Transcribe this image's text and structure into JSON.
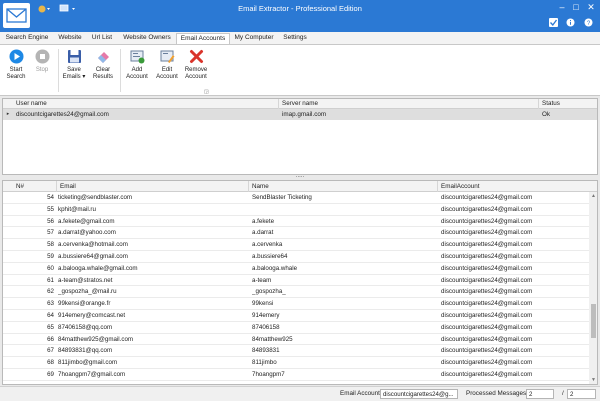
{
  "window": {
    "title": "Email Extractor - Professional Edition"
  },
  "tabs": [
    {
      "label": "Search Engine"
    },
    {
      "label": "Website"
    },
    {
      "label": "Url List"
    },
    {
      "label": "Website Owners"
    },
    {
      "label": "Email Accounts"
    },
    {
      "label": "My Computer"
    },
    {
      "label": "Settings"
    }
  ],
  "ribbon": {
    "start": "Start Search",
    "stop": "Stop",
    "save": "Save Emails ▾",
    "clear": "Clear Results",
    "add": "Add Account",
    "edit": "Edit Account",
    "remove": "Remove Account"
  },
  "accounts_grid": {
    "columns": [
      "User name",
      "Server name",
      "Status"
    ],
    "rows": [
      {
        "indicator": "▸",
        "user": "discountcigarettes24@gmail.com",
        "server": "imap.gmail.com",
        "status": "Ok"
      }
    ]
  },
  "splitter_grip": ".....",
  "emails_grid": {
    "columns": [
      "N#",
      "Email",
      "Name",
      "EmailAccount"
    ],
    "rows": [
      {
        "num": "54",
        "email": "ticketing@sendblaster.com",
        "name": "SendBlaster Ticketing",
        "account": "discountcigarettes24@gmail.com"
      },
      {
        "num": "55",
        "email": "kphit@mail.ru",
        "name": "",
        "account": "discountcigarettes24@gmail.com"
      },
      {
        "num": "56",
        "email": "a.fekete@gmail.com",
        "name": "a.fekete",
        "account": "discountcigarettes24@gmail.com"
      },
      {
        "num": "57",
        "email": "a.darrat@yahoo.com",
        "name": "a.darrat",
        "account": "discountcigarettes24@gmail.com"
      },
      {
        "num": "58",
        "email": "a.cervenka@hotmail.com",
        "name": "a.cervenka",
        "account": "discountcigarettes24@gmail.com"
      },
      {
        "num": "59",
        "email": "a.bussiere64@gmail.com",
        "name": "a.bussiere64",
        "account": "discountcigarettes24@gmail.com"
      },
      {
        "num": "60",
        "email": "a.balooga.whale@gmail.com",
        "name": "a.balooga.whale",
        "account": "discountcigarettes24@gmail.com"
      },
      {
        "num": "61",
        "email": "a-team@stratos.net",
        "name": "a-team",
        "account": "discountcigarettes24@gmail.com"
      },
      {
        "num": "62",
        "email": "_gospozha_@mail.ru",
        "name": "_gospozha_",
        "account": "discountcigarettes24@gmail.com"
      },
      {
        "num": "63",
        "email": "99kensi@orange.fr",
        "name": "99kensi",
        "account": "discountcigarettes24@gmail.com"
      },
      {
        "num": "64",
        "email": "914emery@comcast.net",
        "name": "914emery",
        "account": "discountcigarettes24@gmail.com"
      },
      {
        "num": "65",
        "email": "87406158@qq.com",
        "name": "87406158",
        "account": "discountcigarettes24@gmail.com"
      },
      {
        "num": "66",
        "email": "84matthew925@gmail.com",
        "name": "84matthew925",
        "account": "discountcigarettes24@gmail.com"
      },
      {
        "num": "67",
        "email": "84893831@qq.com",
        "name": "84893831",
        "account": "discountcigarettes24@gmail.com"
      },
      {
        "num": "68",
        "email": "811jimbo@gmail.com",
        "name": "811jimbo",
        "account": "discountcigarettes24@gmail.com"
      },
      {
        "num": "69",
        "email": "7hoangpm7@gmail.com",
        "name": "7hoangpm7",
        "account": "discountcigarettes24@gmail.com"
      }
    ]
  },
  "statusbar": {
    "email_account_label": "Email Account",
    "email_account_value": "discountcigarettes24@g...",
    "processed_label": "Processed Messages",
    "processed_value": "2",
    "separator": "/",
    "total_value": "2"
  },
  "colors": {
    "titlebar": "#2b79d4",
    "accent_blue": "#1e88e5",
    "remove_red": "#d9342b",
    "selected_row": "#dedede"
  },
  "icons": {
    "app": "envelope-icon",
    "start": "play-circle-icon",
    "stop": "stop-circle-icon",
    "save": "floppy-disk-icon",
    "clear": "eraser-icon",
    "add": "add-account-icon",
    "edit": "edit-account-icon",
    "remove": "red-x-icon"
  }
}
